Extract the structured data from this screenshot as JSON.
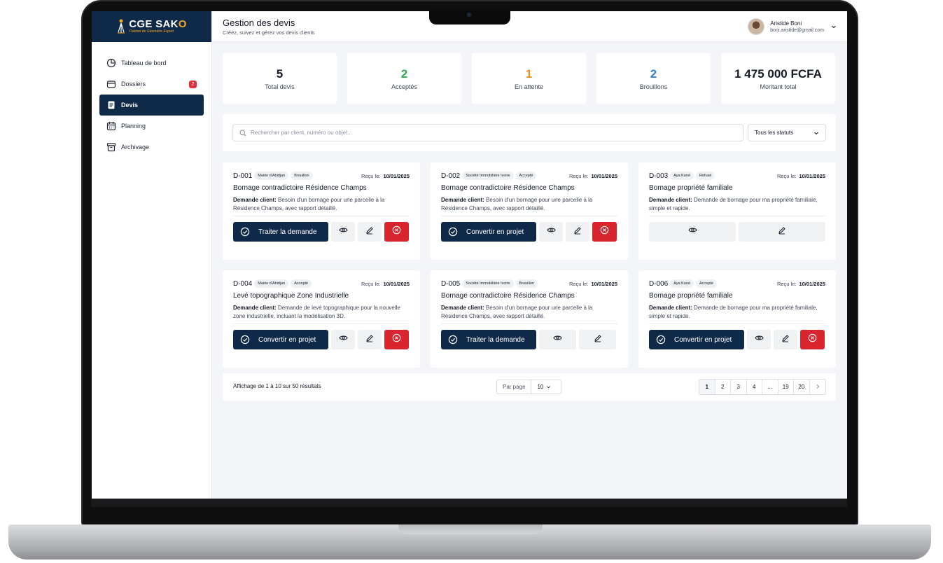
{
  "brand": {
    "name_main": "CGE SAK",
    "name_accent": "O",
    "subtitle": "Cabinet de Géomètre Expert"
  },
  "sidebar": {
    "items": [
      {
        "label": "Tableau de bord",
        "icon": "pie-chart-icon",
        "active": false
      },
      {
        "label": "Dossiers",
        "icon": "folder-icon",
        "active": false,
        "badge": "2"
      },
      {
        "label": "Devis",
        "icon": "document-icon",
        "active": true
      },
      {
        "label": "Planning",
        "icon": "calendar-icon",
        "active": false
      },
      {
        "label": "Archivage",
        "icon": "archive-icon",
        "active": false
      }
    ]
  },
  "header": {
    "title": "Gestion des devis",
    "subtitle": "Créez, suivez et gérez vos devis clients",
    "user_name": "Aristide Boni",
    "user_email": "boni.aristide@gmail.com"
  },
  "stats": [
    {
      "value": "5",
      "label": "Total devis",
      "color": "#141a26"
    },
    {
      "value": "2",
      "label": "Acceptés",
      "color": "#2fa84f"
    },
    {
      "value": "1",
      "label": "En attente",
      "color": "#f28b1e"
    },
    {
      "value": "2",
      "label": "Brouillons",
      "color": "#2f7fd3"
    },
    {
      "value": "1 475 000 FCFA",
      "label": "Montant total",
      "color": "#141a26"
    }
  ],
  "filters": {
    "search_placeholder": "Rechercher par client, numéro ou objet...",
    "status_value": "Tous les statuts"
  },
  "received_label": "Reçu le:",
  "request_label": "Demande client:",
  "cards": [
    {
      "id": "D-001",
      "client": "Mairie d'Abidjan",
      "status": "Brouillon",
      "date": "10/01/2025",
      "title": "Bornage contradictoire Résidence Champs",
      "desc": "Besoin d'un bornage pour une parcelle à la Résidence Champs, avec rapport détaillé.",
      "primary": "Traiter la demande"
    },
    {
      "id": "D-002",
      "client": "Société Immobilière Ivoire",
      "status": "Accepté",
      "date": "10/01/2025",
      "title": "Bornage contradictoire Résidence Champs",
      "desc": "Besoin d'un bornage pour une parcelle à la Résidence Champs, avec rapport détaillé.",
      "primary": "Convertir en projet"
    },
    {
      "id": "D-003",
      "client": "Aya Koné",
      "status": "Refusé",
      "date": "10/01/2025",
      "title": "Bornage propriété familiale",
      "desc": "Demande de bornage pour ma propriété familiale, simple et rapide.",
      "primary": ""
    },
    {
      "id": "D-004",
      "client": "Mairie d'Abidjan",
      "status": "Accepté",
      "date": "10/01/2025",
      "title": "Levé topographique Zone Industrielle",
      "desc": "Demande de levé topographique pour la nouvelle zone industrielle, incluant la modélisation 3D.",
      "primary": "Convertir en projet"
    },
    {
      "id": "D-005",
      "client": "Société Immobilière Ivoire",
      "status": "Brouillon",
      "date": "10/01/2025",
      "title": "Bornage contradictoire Résidence Champs",
      "desc": "Besoin d'un bornage pour une parcelle à la Résidence Champs, avec rapport détaillé.",
      "primary": "Traiter la demande"
    },
    {
      "id": "D-006",
      "client": "Aya Koné",
      "status": "Accepté",
      "date": "10/01/2025",
      "title": "Bornage propriété familiale",
      "desc": "Demande de bornage pour ma propriété familiale, simple et rapide.",
      "primary": "Convertir en projet"
    }
  ],
  "pagination": {
    "info": "Affichage de 1 à 10 sur 50 résultats",
    "per_page_label": "Par page",
    "per_page_value": "10",
    "pages": [
      "1",
      "2",
      "3",
      "4",
      "...",
      "19",
      "20"
    ],
    "current": "1"
  }
}
